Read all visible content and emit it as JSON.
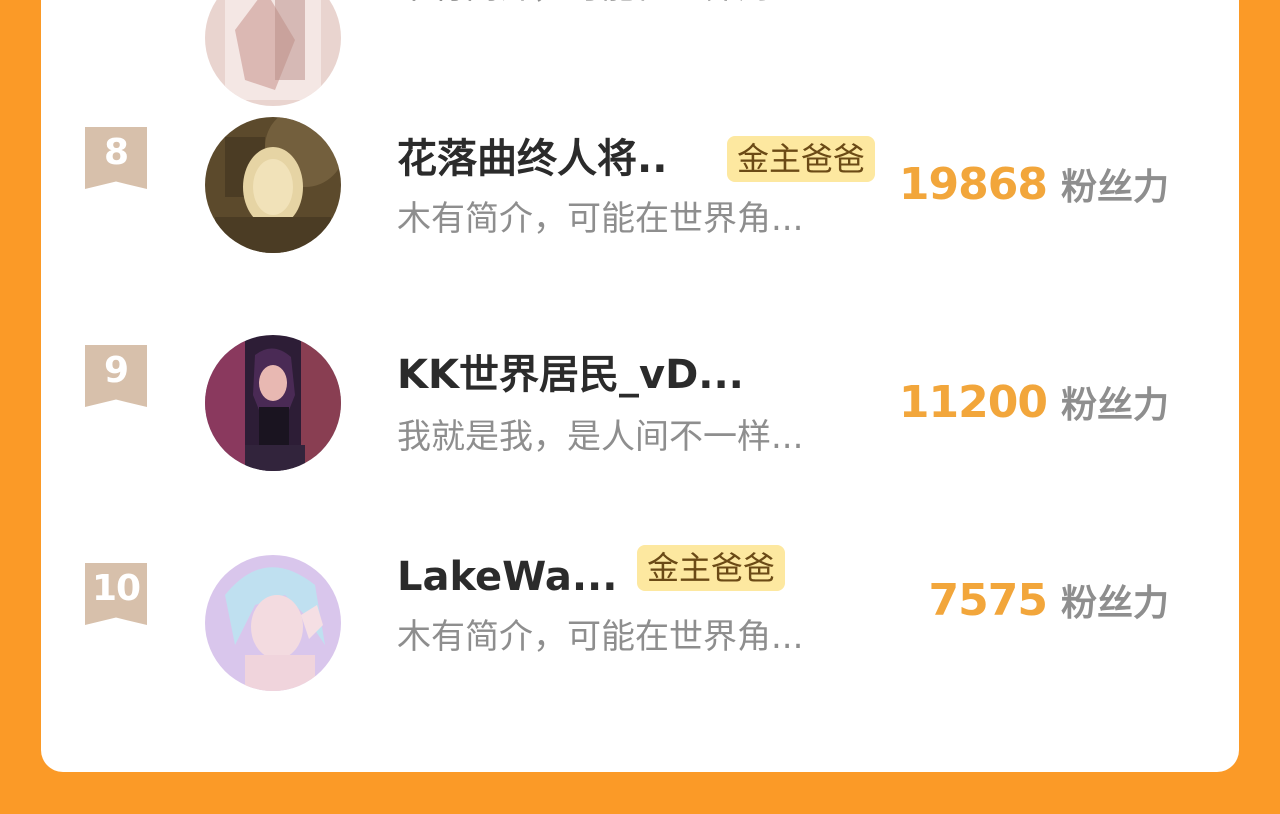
{
  "top_partial": {
    "desc": "木有简介，可能在世界角..."
  },
  "rows": [
    {
      "rank": "8",
      "name": "花落曲终人将..",
      "badge": "金主爸爸",
      "desc": "木有简介，可能在世界角...",
      "fans": "19868",
      "fans_unit": "粉丝力",
      "avatar_icon": "avatar-image"
    },
    {
      "rank": "9",
      "name": "KK世界居民_vD...",
      "desc": "我就是我，是人间不一样...",
      "fans": "11200",
      "fans_unit": "粉丝力",
      "avatar_icon": "avatar-image"
    },
    {
      "rank": "10",
      "name": "LakeWa...",
      "badge": "金主爸爸",
      "desc": "木有简介，可能在世界角...",
      "fans": "7575",
      "fans_unit": "粉丝力",
      "avatar_icon": "avatar-image"
    }
  ],
  "colors": {
    "page_background": "#fb9a27",
    "card": "#ffffff",
    "rank_ribbon": "#d7c0ab",
    "fans_number": "#f2a63b",
    "badge_background": "#fde8a0",
    "badge_text": "#6b4a16",
    "muted_text": "#8e8e8e"
  }
}
